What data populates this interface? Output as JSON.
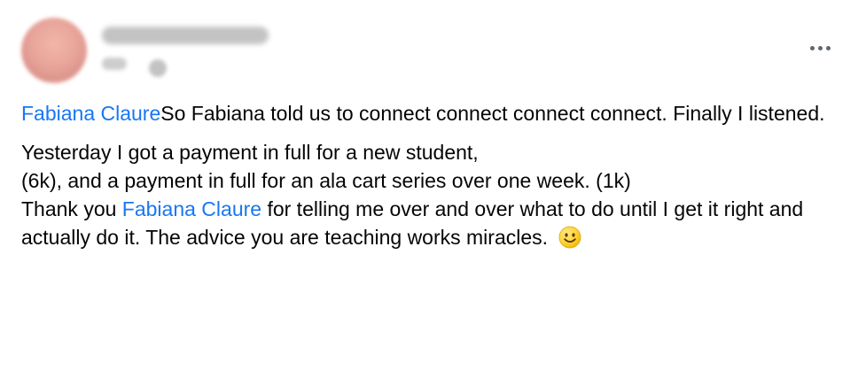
{
  "post": {
    "first_para": {
      "mention": "Fabiana Claure",
      "text": "So Fabiana told us to connect connect connect connect. Finally I listened."
    },
    "second_para": {
      "line1": "Yesterday I got a payment in full for a new student,",
      "line2": "(6k), and a payment in full for an ala cart series over one week. (1k)",
      "thank": "Thank you ",
      "mention": "Fabiana Claure",
      "rest": " for telling me over and over what to do until I get it right and actually do it. The advice you are teaching works miracles."
    }
  },
  "icons": {
    "more": "more-horizontal-icon",
    "emoji": "smile-emoji-icon"
  },
  "colors": {
    "mention": "#1877f2",
    "text": "#050505",
    "muted": "#606770"
  }
}
